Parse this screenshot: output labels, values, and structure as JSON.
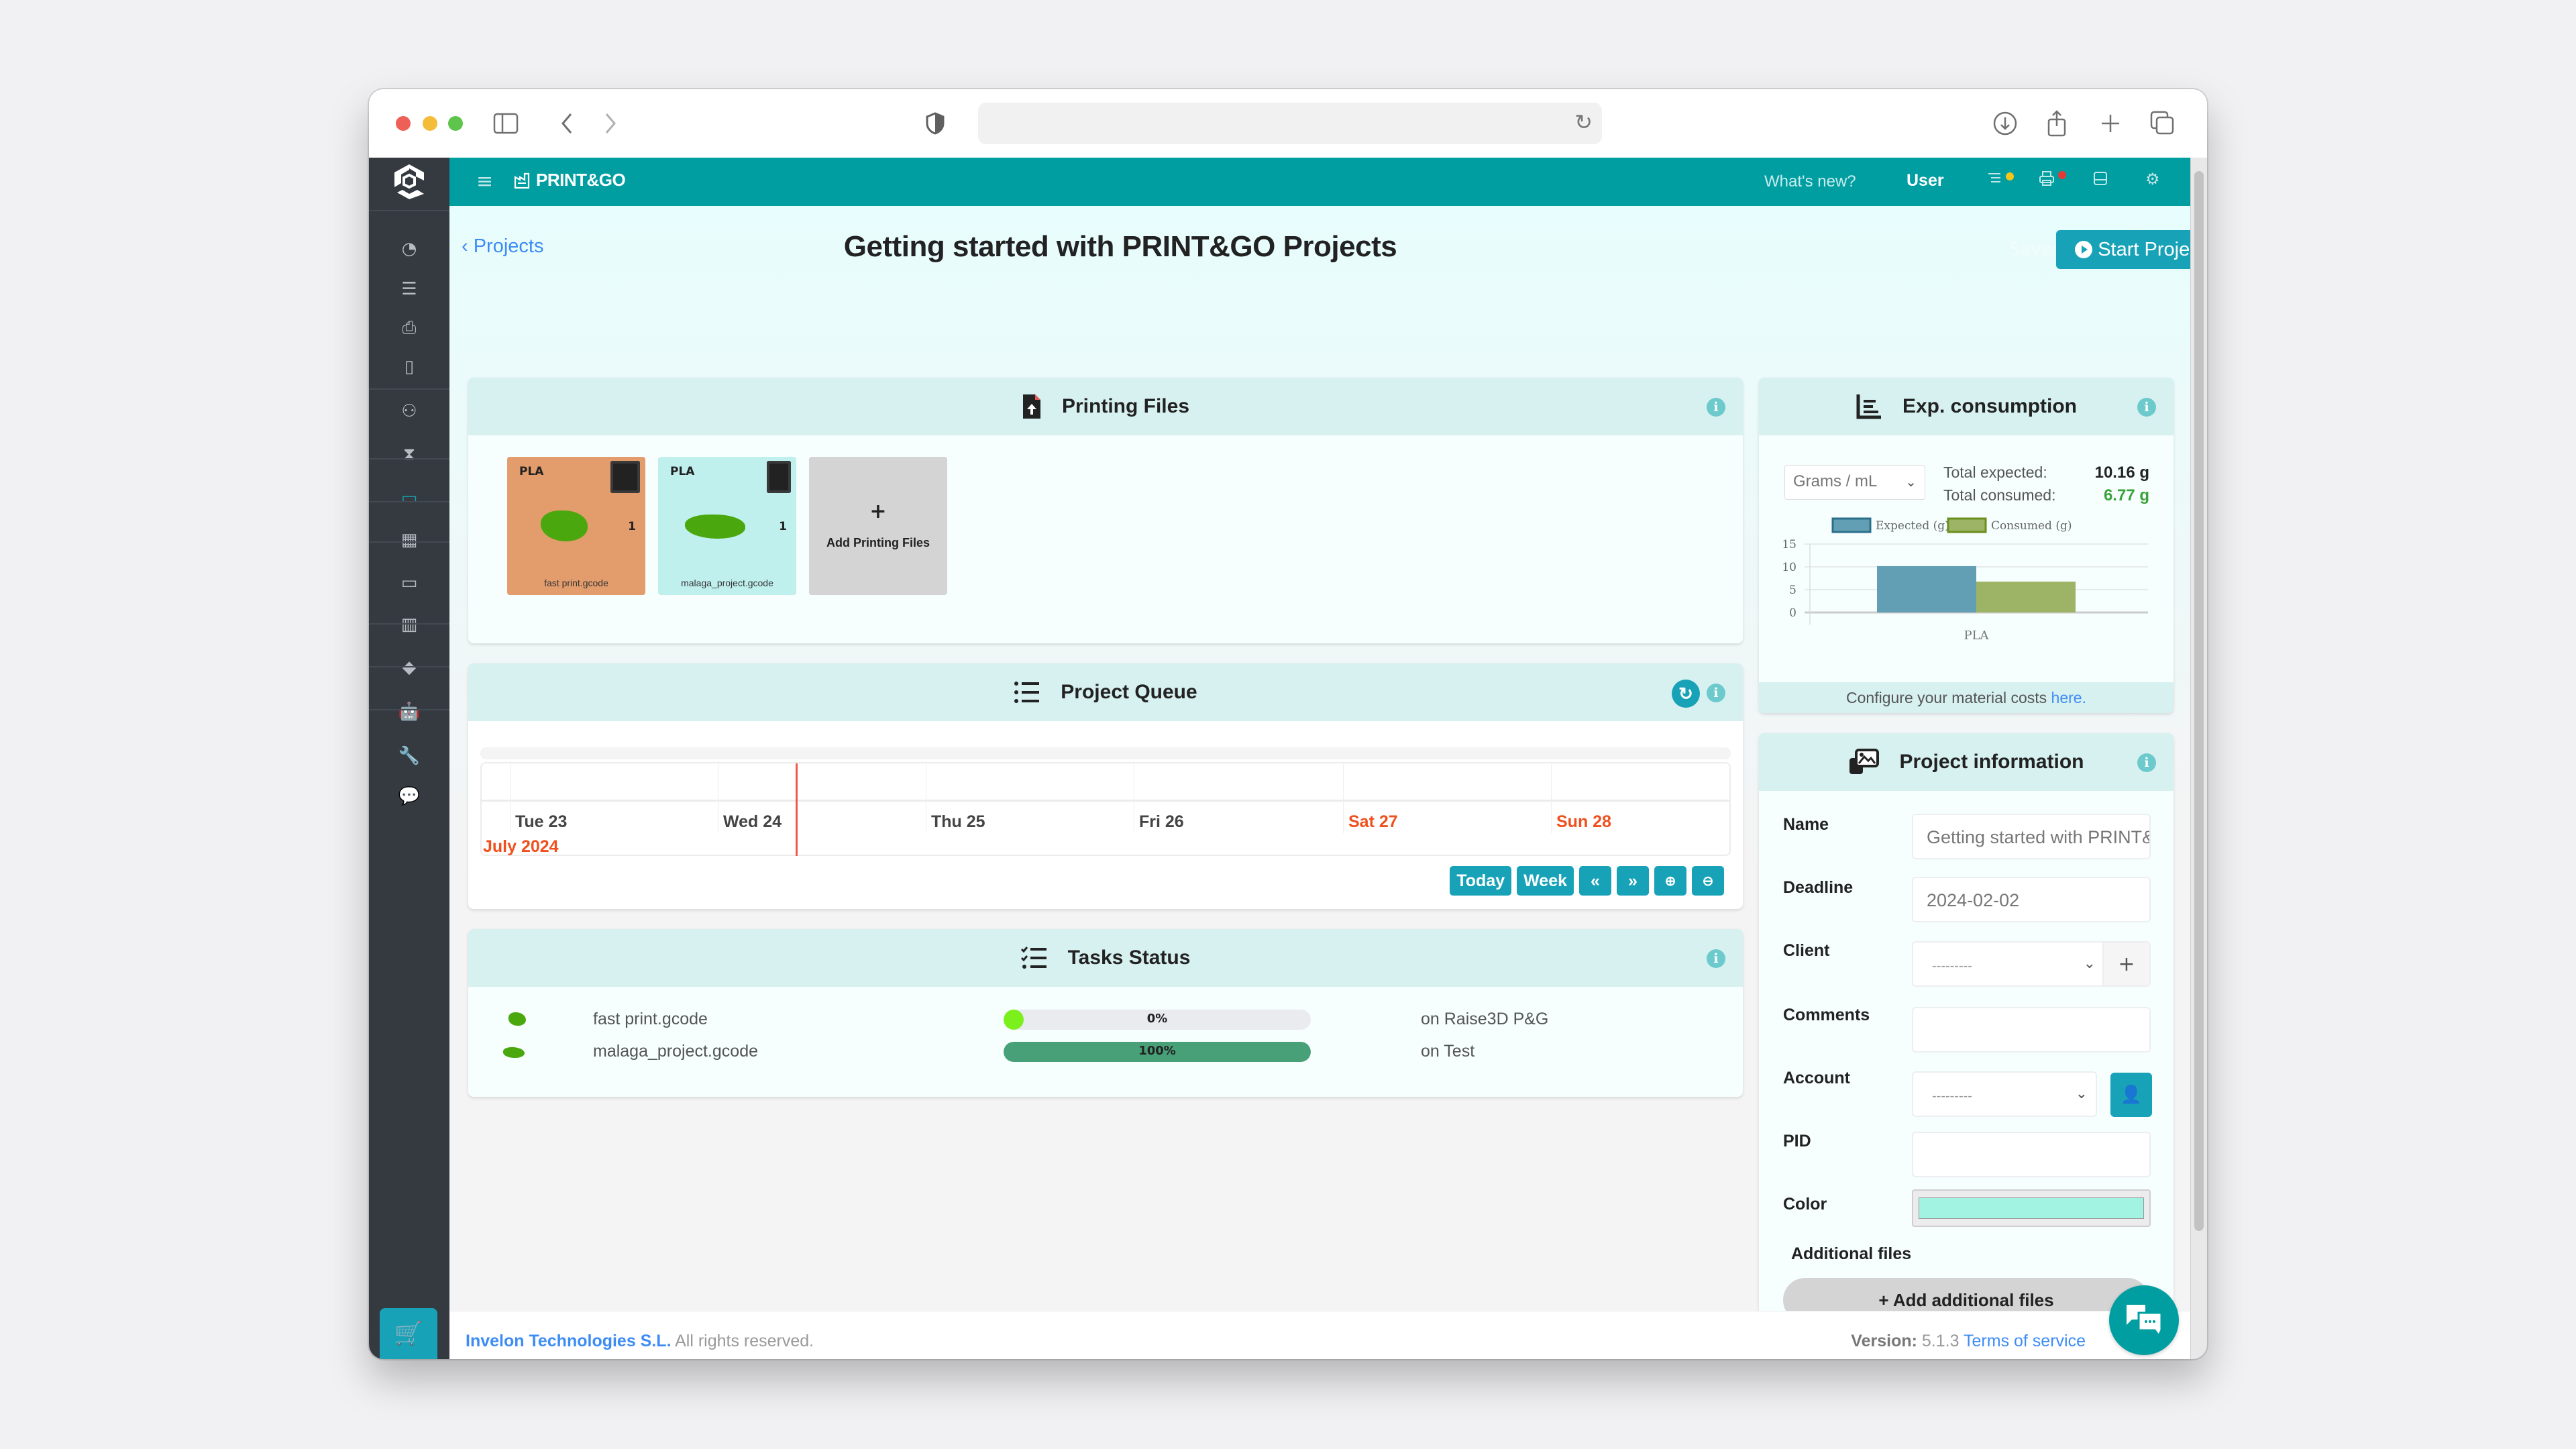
{
  "browser": {
    "icons": [
      "sidebar-toggle-icon",
      "back-icon",
      "forward-icon",
      "shield-icon",
      "reload-icon",
      "download-icon",
      "share-icon",
      "new-tab-icon",
      "tabs-overview-icon"
    ]
  },
  "header": {
    "brand": "PRINT&GO",
    "whats_new": "What's new?",
    "user": "User",
    "status_dots": {
      "queue": "#f5c518",
      "printers": "#e53935"
    }
  },
  "sidebar": {
    "items": [
      {
        "icon": "dashboard-icon"
      },
      {
        "icon": "queue-icon"
      },
      {
        "icon": "printer-icon"
      },
      {
        "icon": "book-icon"
      },
      {
        "icon": "users-icon"
      },
      {
        "icon": "hourglass-icon"
      },
      {
        "icon": "projects-icon",
        "active": true
      },
      {
        "icon": "calculator-icon"
      },
      {
        "icon": "monitor-icon"
      },
      {
        "icon": "stats-icon"
      },
      {
        "icon": "gem-icon"
      },
      {
        "icon": "robot-icon"
      },
      {
        "icon": "wrench-icon"
      },
      {
        "icon": "chat-icon"
      }
    ],
    "cart_icon": "cart-icon"
  },
  "page": {
    "back_link": "Projects",
    "title": "Getting started with PRINT&GO Projects",
    "saved": "Saved",
    "start_button": "Start Project"
  },
  "printing_files": {
    "title": "Printing Files",
    "files": [
      {
        "material": "PLA",
        "quantity": "1",
        "name": "fast print.gcode",
        "bg": "#e39c6c"
      },
      {
        "material": "PLA",
        "quantity": "1",
        "name": "malaga_project.gcode",
        "bg": "#bff0ee"
      }
    ],
    "add_label": "Add Printing Files",
    "add_symbol": "+"
  },
  "consumption": {
    "title": "Exp. consumption",
    "unit_select": "Grams / mL",
    "total_expected_label": "Total expected:",
    "total_expected_value": "10.16 g",
    "total_consumed_label": "Total consumed:",
    "total_consumed_value": "6.77 g",
    "footer_text": "Configure your material costs ",
    "footer_link": "here."
  },
  "chart_data": {
    "type": "bar",
    "categories": [
      "PLA"
    ],
    "series": [
      {
        "name": "Expected (g)",
        "values": [
          10.16
        ],
        "color": "#629fb5"
      },
      {
        "name": "Consumed (g)",
        "values": [
          6.77
        ],
        "color": "#9db365"
      }
    ],
    "ylim": [
      0,
      15
    ],
    "yticks": [
      0,
      5,
      10,
      15
    ],
    "legend": "top",
    "grid": true,
    "title": "",
    "xlabel": "",
    "ylabel": ""
  },
  "queue": {
    "title": "Project Queue",
    "days": [
      {
        "label": "Tue 23",
        "weekend": false
      },
      {
        "label": "Wed 24",
        "weekend": false
      },
      {
        "label": "Thu 25",
        "weekend": false
      },
      {
        "label": "Fri 26",
        "weekend": false
      },
      {
        "label": "Sat 27",
        "weekend": true
      },
      {
        "label": "Sun 28",
        "weekend": true
      }
    ],
    "month": "July 2024",
    "buttons": [
      "Today",
      "Week",
      "«",
      "»",
      "🔍",
      "🔍"
    ]
  },
  "tasks": {
    "title": "Tasks Status",
    "rows": [
      {
        "file": "fast print.gcode",
        "progress": 0,
        "progress_label": "0%",
        "printer": "on Raise3D P&G",
        "fill": "#7cf01c"
      },
      {
        "file": "malaga_project.gcode",
        "progress": 100,
        "progress_label": "100%",
        "printer": "on Test",
        "fill": "#47a077"
      }
    ]
  },
  "project_info": {
    "title": "Project information",
    "name_label": "Name",
    "name_value": "Getting started with PRINT&GO Projects",
    "deadline_label": "Deadline",
    "deadline_value": "2024-02-02",
    "client_label": "Client",
    "client_value": "---------",
    "comments_label": "Comments",
    "comments_value": "",
    "account_label": "Account",
    "account_value": "---------",
    "pid_label": "PID",
    "pid_value": "",
    "color_label": "Color",
    "color_value": "#a3f3e3",
    "additional_files_label": "Additional files",
    "add_additional_button": "+ Add additional files"
  },
  "footer": {
    "company": "Invelon Technologies S.L.",
    "rights": " All rights reserved.",
    "version_label": "Version:",
    "version": "5.1.3",
    "terms": "Terms of service"
  }
}
